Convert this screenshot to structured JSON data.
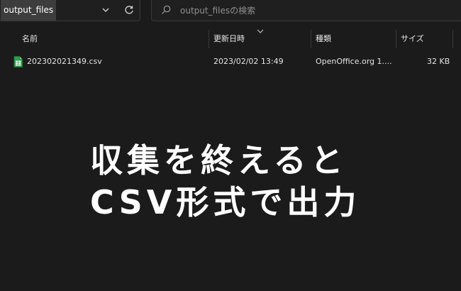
{
  "address": {
    "current_folder": "output_files"
  },
  "search": {
    "placeholder": "output_filesの検索"
  },
  "columns": {
    "name": "名前",
    "modified": "更新日時",
    "type": "種類",
    "size": "サイズ"
  },
  "files": [
    {
      "name": "202302021349.csv",
      "modified": "2023/02/02 13:49",
      "type": "OpenOffice.org 1....",
      "size": "32 KB",
      "icon": "spreadsheet-file-icon"
    }
  ],
  "overlay": {
    "line1": "収集を終えると",
    "line2": "CSV形式で出力"
  },
  "colors": {
    "background": "#1b1b1b",
    "crumb_highlight": "#3d3d3d",
    "file_icon": "#2e9e4a"
  }
}
